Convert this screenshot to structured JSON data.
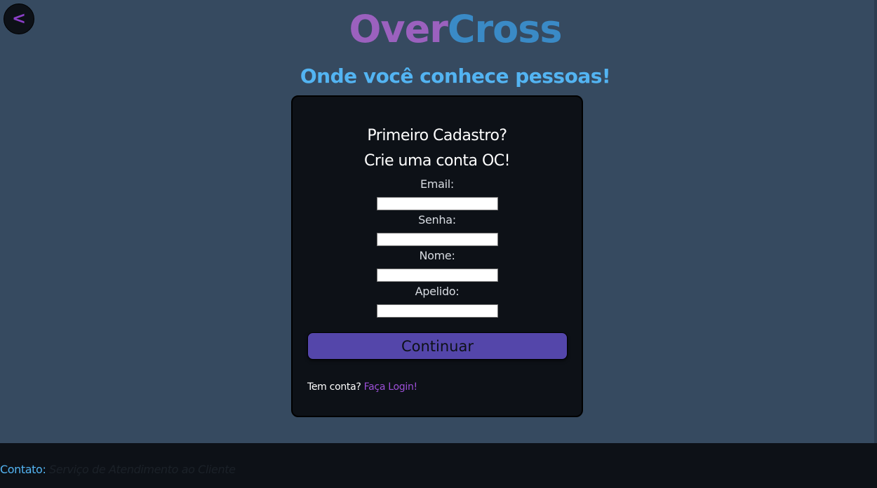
{
  "header": {
    "back_label": "<",
    "logo_part1": "Over",
    "logo_part2": "Cross",
    "tagline": "Onde você conhece pessoas!"
  },
  "signup": {
    "heading_line1": "Primeiro Cadastro?",
    "heading_line2": "Crie uma conta OC!",
    "fields": [
      {
        "label": "Email:",
        "value": ""
      },
      {
        "label": "Senha:",
        "value": ""
      },
      {
        "label": "Nome:",
        "value": ""
      },
      {
        "label": "Apelido:",
        "value": ""
      }
    ],
    "continue_label": "Continuar",
    "login_prompt": "Tem conta?",
    "login_link": "Faça Login!"
  },
  "footer": {
    "contact_label": "Contato:",
    "contact_value": "Serviço de Atendimento ao Cliente"
  },
  "colors": {
    "background": "#364a60",
    "card": "#0d1117",
    "logo_over": "#9b61be",
    "logo_cross": "#3a8ac6",
    "tagline": "#53b4f2",
    "button": "#5446aa",
    "link": "#9b4fd6"
  }
}
